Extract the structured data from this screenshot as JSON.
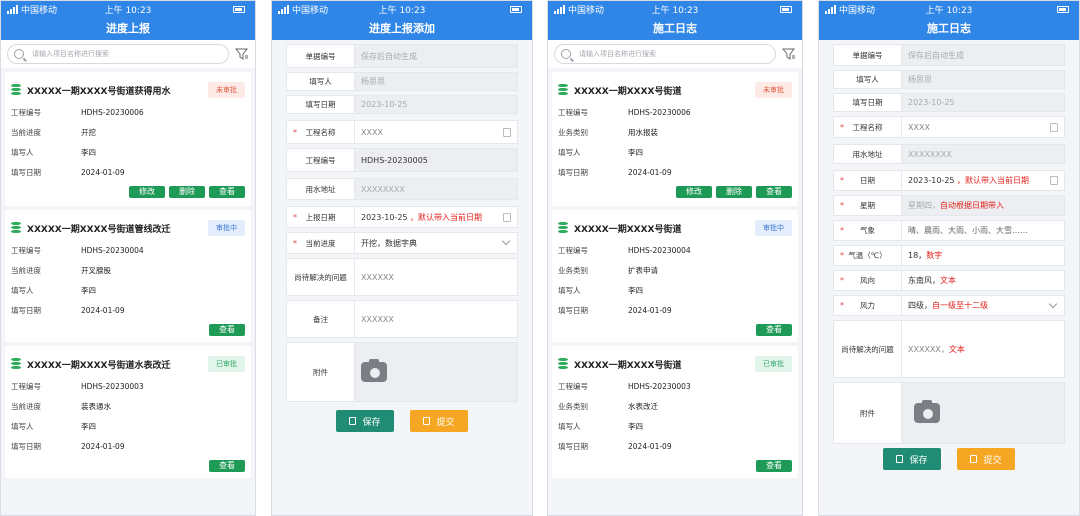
{
  "status": {
    "carrier": "中国移动",
    "time": "上午 10:23"
  },
  "screen1": {
    "title": "进度上报",
    "search_placeholder": "请输入项目名称进行搜索",
    "cards": [
      {
        "title": "XXXXX一期XXXX号街道获得用水",
        "badge": "未审批",
        "badge_type": "red",
        "rows": [
          {
            "k": "工程编号",
            "v": "HDHS-20230006"
          },
          {
            "k": "当前进度",
            "v": "开挖"
          },
          {
            "k": "填写人",
            "v": "李四"
          },
          {
            "k": "填写日期",
            "v": "2024-01-09"
          }
        ],
        "buttons": [
          "修改",
          "删除",
          "查看"
        ]
      },
      {
        "title": "XXXXX一期XXXX号街道管线改迁",
        "badge": "审批中",
        "badge_type": "blue",
        "rows": [
          {
            "k": "工程编号",
            "v": "HDHS-20230004"
          },
          {
            "k": "当前进度",
            "v": "开叉腺股"
          },
          {
            "k": "填写人",
            "v": "李四"
          },
          {
            "k": "填写日期",
            "v": "2024-01-09"
          }
        ],
        "buttons": [
          "查看"
        ]
      },
      {
        "title": "XXXXX一期XXXX号街道水表改迁",
        "badge": "已审批",
        "badge_type": "green",
        "rows": [
          {
            "k": "工程编号",
            "v": "HDHS-20230003"
          },
          {
            "k": "当前进度",
            "v": "装表通水"
          },
          {
            "k": "填写人",
            "v": "李四"
          },
          {
            "k": "填写日期",
            "v": "2024-01-09"
          }
        ],
        "buttons": [
          "查看"
        ]
      }
    ]
  },
  "screen2": {
    "title": "进度上报添加",
    "fields": {
      "doc_no": {
        "label": "单据编号",
        "value": "保存后自动生成"
      },
      "filler": {
        "label": "填写人",
        "value": "杨思思"
      },
      "fill_date": {
        "label": "填写日期",
        "value": "2023-10-25"
      },
      "project_name": {
        "label": "工程名称",
        "value": "XXXX"
      },
      "project_no": {
        "label": "工程编号",
        "value": "HDHS-20230005"
      },
      "water_addr": {
        "label": "用水地址",
        "value": "XXXXXXXX"
      },
      "report_date": {
        "label": "上报日期",
        "value": "2023-10-25",
        "hint": "，默认带入当前日期"
      },
      "progress": {
        "label": "当前进度",
        "value": "开挖，数据字典"
      },
      "issues": {
        "label": "尚待解决的问题",
        "value": "XXXXXX"
      },
      "remark": {
        "label": "备注",
        "value": "XXXXXX"
      },
      "attachment": {
        "label": "附件"
      }
    },
    "save_label": "保存",
    "submit_label": "提交"
  },
  "screen3": {
    "title": "施工日志",
    "search_placeholder": "请输入项目名称进行搜索",
    "cards": [
      {
        "title": "XXXXX一期XXXX号街道",
        "badge": "未审批",
        "badge_type": "red",
        "rows": [
          {
            "k": "工程编号",
            "v": "HDHS-20230006"
          },
          {
            "k": "业务类别",
            "v": "用水报装"
          },
          {
            "k": "填写人",
            "v": "李四"
          },
          {
            "k": "填写日期",
            "v": "2024-01-09"
          }
        ],
        "buttons": [
          "修改",
          "删除",
          "查看"
        ]
      },
      {
        "title": "XXXXX一期XXXX号街道",
        "badge": "审批中",
        "badge_type": "blue",
        "rows": [
          {
            "k": "工程编号",
            "v": "HDHS-20230004"
          },
          {
            "k": "业务类别",
            "v": "扩表申请"
          },
          {
            "k": "填写人",
            "v": "李四"
          },
          {
            "k": "填写日期",
            "v": "2024-01-09"
          }
        ],
        "buttons": [
          "查看"
        ]
      },
      {
        "title": "XXXXX一期XXXX号街道",
        "badge": "已审批",
        "badge_type": "green",
        "rows": [
          {
            "k": "工程编号",
            "v": "HDHS-20230003"
          },
          {
            "k": "业务类别",
            "v": "水表改迁"
          },
          {
            "k": "填写人",
            "v": "李四"
          },
          {
            "k": "填写日期",
            "v": "2024-01-09"
          }
        ],
        "buttons": [
          "查看"
        ]
      }
    ]
  },
  "screen4": {
    "title": "施工日志",
    "fields": {
      "doc_no": {
        "label": "单据编号",
        "value": "保存后自动生成"
      },
      "filler": {
        "label": "填写人",
        "value": "杨思思"
      },
      "fill_date": {
        "label": "填写日期",
        "value": "2023-10-25"
      },
      "project_name": {
        "label": "工程名称",
        "value": "XXXX"
      },
      "water_addr": {
        "label": "用水地址",
        "value": "XXXXXXXX"
      },
      "date": {
        "label": "日期",
        "value": "2023-10-25",
        "hint": "，默认带入当前日期"
      },
      "weekday": {
        "label": "星期",
        "value": "星期四，",
        "hint": "自动根据日期带入"
      },
      "weather": {
        "label": "气象",
        "value": "晴、晨雨、大雨、小雨、大雪……"
      },
      "temperature": {
        "label": "气温（℃）",
        "value": "18，",
        "hint": "数字"
      },
      "wind_dir": {
        "label": "风向",
        "value": "东南风，",
        "hint": "文本"
      },
      "wind_force": {
        "label": "风力",
        "value": "四级，",
        "hint": "自一级至十二级"
      },
      "issues": {
        "label": "尚待解决的问题",
        "value": "XXXXXX，",
        "hint": "文本"
      },
      "attachment": {
        "label": "附件"
      }
    },
    "save_label": "保存",
    "submit_label": "提交"
  }
}
